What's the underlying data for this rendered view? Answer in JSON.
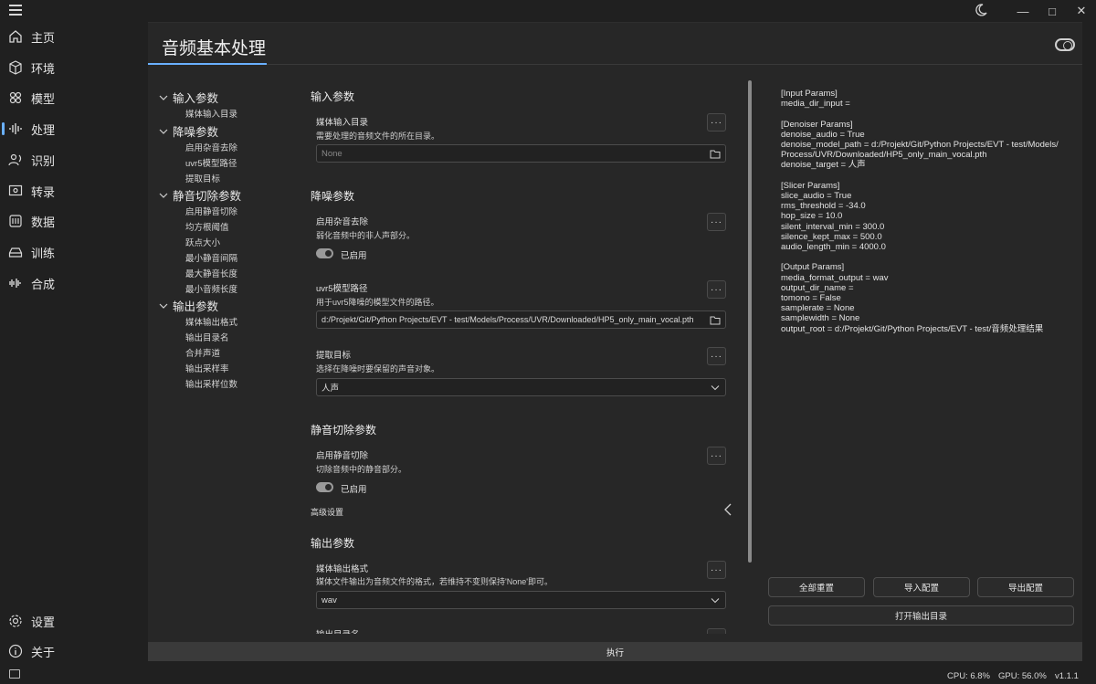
{
  "window": {
    "controls": [
      "moon-icon",
      "minimize",
      "maximize",
      "close"
    ]
  },
  "nav": {
    "items": [
      {
        "label": "主页",
        "icon": "home-icon"
      },
      {
        "label": "环境",
        "icon": "cube-icon"
      },
      {
        "label": "模型",
        "icon": "molecule-icon"
      },
      {
        "label": "处理",
        "icon": "waveform-icon"
      },
      {
        "label": "识别",
        "icon": "speech-icon"
      },
      {
        "label": "转录",
        "icon": "transcribe-icon"
      },
      {
        "label": "数据",
        "icon": "database-icon"
      },
      {
        "label": "训练",
        "icon": "drive-icon"
      },
      {
        "label": "合成",
        "icon": "synthesis-icon"
      }
    ],
    "settings": "设置",
    "about": "关于"
  },
  "page": {
    "title": "音频基本处理"
  },
  "tree": {
    "g1": "输入参数",
    "g1c": [
      "媒体输入目录"
    ],
    "g2": "降噪参数",
    "g2c": [
      "启用杂音去除",
      "uvr5模型路径",
      "提取目标"
    ],
    "g3": "静音切除参数",
    "g3c": [
      "启用静音切除",
      "均方根阈值",
      "跃点大小",
      "最小静音间隔",
      "最大静音长度",
      "最小音频长度"
    ],
    "g4": "输出参数",
    "g4c": [
      "媒体输出格式",
      "输出目录名",
      "合并声道",
      "输出采样率",
      "输出采样位数"
    ]
  },
  "form": {
    "input_section": "输入参数",
    "media_input_label": "媒体输入目录",
    "media_input_desc": "需要处理的音频文件的所在目录。",
    "media_input_placeholder": "None",
    "denoise_section": "降噪参数",
    "denoise_enable_label": "启用杂音去除",
    "denoise_enable_desc": "弱化音频中的非人声部分。",
    "denoise_enable_state": "已启用",
    "uvr5_label": "uvr5模型路径",
    "uvr5_desc": "用于uvr5降噪的模型文件的路径。",
    "uvr5_value": "d:/Projekt/Git/Python Projects/EVT - test/Models/Process/UVR/Downloaded/HP5_only_main_vocal.pth",
    "target_label": "提取目标",
    "target_desc": "选择在降噪时要保留的声音对象。",
    "target_value": "人声",
    "slicer_section": "静音切除参数",
    "slicer_enable_label": "启用静音切除",
    "slicer_enable_desc": "切除音频中的静音部分。",
    "slicer_enable_state": "已启用",
    "advanced": "高级设置",
    "output_section": "输出参数",
    "format_label": "媒体输出格式",
    "format_desc": "媒体文件输出为音频文件的格式，若维持不变则保持'None'即可。",
    "format_value": "wav",
    "outdir_label_partial": "输出目录名"
  },
  "console": {
    "text": "[Input Params]\nmedia_dir_input =\n\n[Denoiser Params]\ndenoise_audio = True\ndenoise_model_path = d:/Projekt/Git/Python Projects/EVT - test/Models/\nProcess/UVR/Downloaded/HP5_only_main_vocal.pth\ndenoise_target = 人声\n\n[Slicer Params]\nslice_audio = True\nrms_threshold = -34.0\nhop_size = 10.0\nsilent_interval_min = 300.0\nsilence_kept_max = 500.0\naudio_length_min = 4000.0\n\n[Output Params]\nmedia_format_output = wav\noutput_dir_name =\ntomono = False\nsamplerate = None\nsamplewidth = None\noutput_root = d:/Projekt/Git/Python Projects/EVT - test/音频处理结果"
  },
  "buttons": {
    "reset_all": "全部重置",
    "import_config": "导入配置",
    "export_config": "导出配置",
    "open_output_dir": "打开输出目录",
    "execute": "执行"
  },
  "status": {
    "cpu": "CPU: 6.8%",
    "gpu": "GPU: 56.0%",
    "version": "v1.1.1"
  },
  "colors": {
    "accent": "#6ab0ff",
    "background": "#202020",
    "panel": "#272727"
  }
}
